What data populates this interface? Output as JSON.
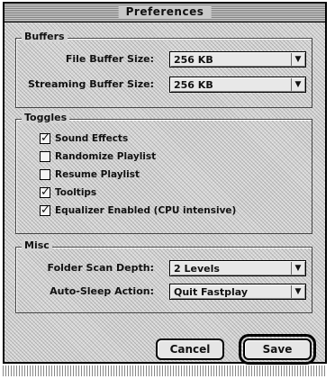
{
  "window": {
    "title": "Preferences"
  },
  "buffers": {
    "legend": "Buffers",
    "file_buffer": {
      "label": "File Buffer Size:",
      "value": "256 KB"
    },
    "streaming_buffer": {
      "label": "Streaming Buffer Size:",
      "value": "256 KB"
    }
  },
  "toggles": {
    "legend": "Toggles",
    "items": [
      {
        "label": "Sound Effects",
        "checked": true
      },
      {
        "label": "Randomize Playlist",
        "checked": false
      },
      {
        "label": "Resume Playlist",
        "checked": false
      },
      {
        "label": "Tooltips",
        "checked": true
      },
      {
        "label": "Equalizer Enabled (CPU intensive)",
        "checked": true
      }
    ]
  },
  "misc": {
    "legend": "Misc",
    "folder_scan": {
      "label": "Folder Scan Depth:",
      "value": "2 Levels"
    },
    "auto_sleep": {
      "label": "Auto-Sleep Action:",
      "value": "Quit Fastplay"
    }
  },
  "buttons": {
    "cancel": "Cancel",
    "save": "Save"
  },
  "colors": {
    "window_bg": "#d6d6d6",
    "border": "#000000"
  }
}
